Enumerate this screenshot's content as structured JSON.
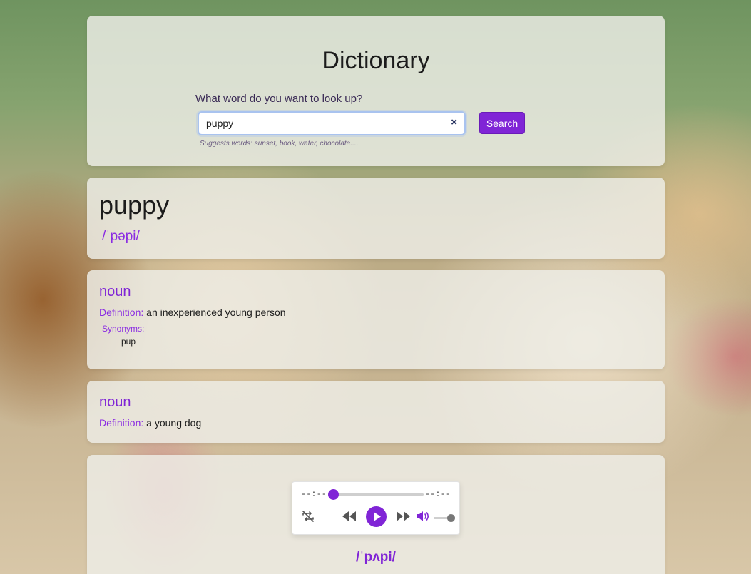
{
  "search": {
    "title": "Dictionary",
    "label": "What word do you want to look up?",
    "value": "puppy",
    "clear_icon": "×",
    "button_label": "Search",
    "hint": "Suggests words: sunset, book, water, chocolate...."
  },
  "word": {
    "text": "puppy",
    "phonetic": "/ˈpəpi/"
  },
  "meanings": [
    {
      "part_of_speech": "noun",
      "definition_label": "Definition:",
      "definition": " an inexperienced young person",
      "synonyms_label": "Synonyms:",
      "synonyms": [
        "pup"
      ]
    },
    {
      "part_of_speech": "noun",
      "definition_label": "Definition:",
      "definition": " a young dog"
    }
  ],
  "audio": {
    "current_time": "--:--",
    "total_time": "--:--",
    "progress": 0,
    "volume": 1,
    "phonetic": "/ˈpʌpi/",
    "icons": [
      "loop-icon",
      "rewind-icon",
      "play-icon",
      "fast-forward-icon",
      "volume-icon"
    ]
  },
  "colors": {
    "accent": "#8025d6",
    "card": "#eeeee8"
  }
}
